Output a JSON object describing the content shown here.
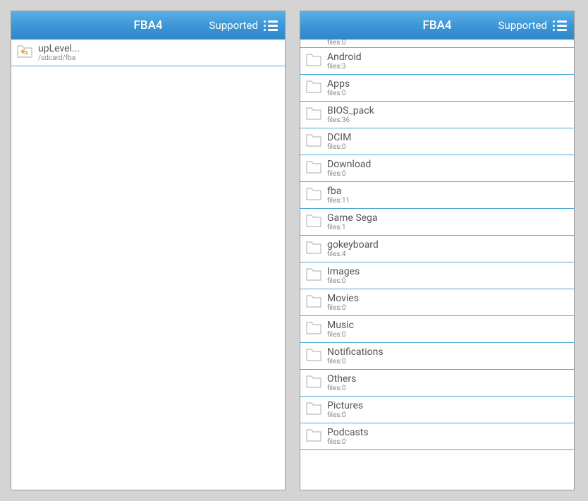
{
  "left": {
    "header": {
      "title": "FBA4",
      "supported": "Supported"
    },
    "items": [
      {
        "name": "upLevel...",
        "sub": "/sdcard/fba",
        "type": "up"
      }
    ]
  },
  "right": {
    "header": {
      "title": "FBA4",
      "supported": "Supported"
    },
    "partial": {
      "sub": "files:0"
    },
    "items": [
      {
        "name": "Android",
        "sub": "files:3"
      },
      {
        "name": "Apps",
        "sub": "files:0"
      },
      {
        "name": "BIOS_pack",
        "sub": "files:36"
      },
      {
        "name": "DCIM",
        "sub": "files:0"
      },
      {
        "name": "Download",
        "sub": "files:0"
      },
      {
        "name": "fba",
        "sub": "files:11"
      },
      {
        "name": "Game Sega",
        "sub": "files:1"
      },
      {
        "name": "gokeyboard",
        "sub": "files:4"
      },
      {
        "name": "Images",
        "sub": "files:0"
      },
      {
        "name": "Movies",
        "sub": "files:0"
      },
      {
        "name": "Music",
        "sub": "files:0"
      },
      {
        "name": "Notifications",
        "sub": "files:0"
      },
      {
        "name": "Others",
        "sub": "files:0"
      },
      {
        "name": "Pictures",
        "sub": "files:0"
      },
      {
        "name": "Podcasts",
        "sub": "files:0"
      }
    ]
  }
}
